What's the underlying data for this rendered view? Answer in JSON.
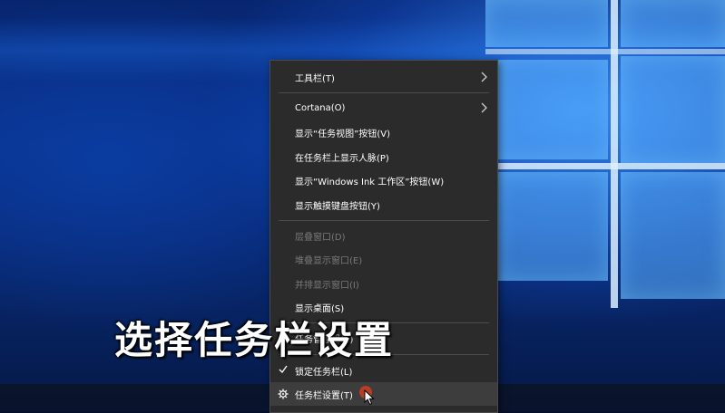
{
  "menu": {
    "items": [
      {
        "label": "工具栏(T)",
        "submenu": true
      },
      {
        "label": "Cortana(O)",
        "submenu": true
      },
      {
        "label": "显示“任务视图”按钮(V)"
      },
      {
        "label": "在任务栏上显示人脉(P)"
      },
      {
        "label": "显示“Windows Ink 工作区”按钮(W)"
      },
      {
        "label": "显示触摸键盘按钮(Y)"
      },
      {
        "label": "层叠窗口(D)",
        "disabled": true
      },
      {
        "label": "堆叠显示窗口(E)",
        "disabled": true
      },
      {
        "label": "并排显示窗口(I)",
        "disabled": true
      },
      {
        "label": "显示桌面(S)"
      },
      {
        "label": "任务管理器(K)"
      },
      {
        "label": "锁定任务栏(L)",
        "checked": true
      },
      {
        "label": "任务栏设置(T)",
        "icon": "gear-icon"
      }
    ]
  },
  "caption": "选择任务栏设置",
  "colors": {
    "menu_bg": "#2b2b2b",
    "menu_text": "#ffffff",
    "disabled_text": "#7a7a7a",
    "click_indicator": "#c9401f"
  }
}
